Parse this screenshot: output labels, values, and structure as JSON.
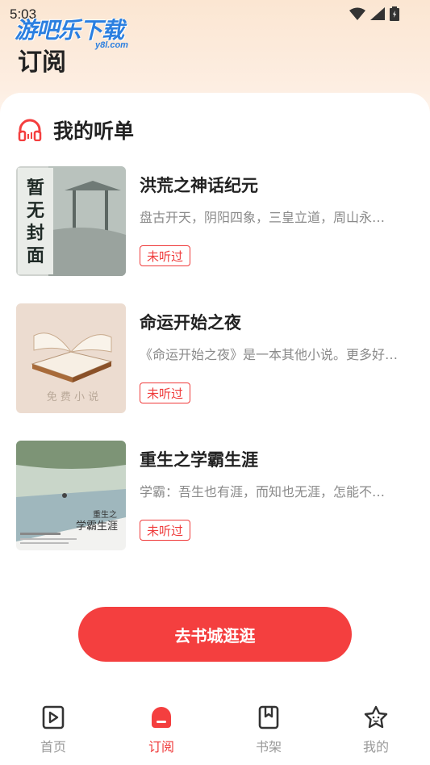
{
  "status_bar": {
    "time": "5:03"
  },
  "watermark": {
    "text": "游吧乐下载",
    "sub": "y8l.com"
  },
  "header": {
    "title": "订阅"
  },
  "section": {
    "title": "我的听单"
  },
  "books": [
    {
      "title": "洪荒之神话纪元",
      "desc": "盘古开天，阴阳四象，三皇立道，周山永…",
      "status": "未听过",
      "cover_text": "暂无封面"
    },
    {
      "title": "命运开始之夜",
      "desc": "《命运开始之夜》是一本其他小说。更多好…",
      "status": "未听过",
      "cover_text": "免费小说"
    },
    {
      "title": "重生之学霸生涯",
      "desc": "学霸：吾生也有涯，而知也无涯，怎能不…",
      "status": "未听过",
      "cover_text": "重生之学霸生涯"
    }
  ],
  "cta": {
    "label": "去书城逛逛"
  },
  "tabs": [
    {
      "label": "首页",
      "icon": "play-book-icon",
      "active": false
    },
    {
      "label": "订阅",
      "icon": "subscribe-icon",
      "active": true
    },
    {
      "label": "书架",
      "icon": "bookmark-icon",
      "active": false
    },
    {
      "label": "我的",
      "icon": "profile-star-icon",
      "active": false
    }
  ],
  "colors": {
    "accent": "#f43f3f",
    "badge": "#ef3b3b"
  }
}
